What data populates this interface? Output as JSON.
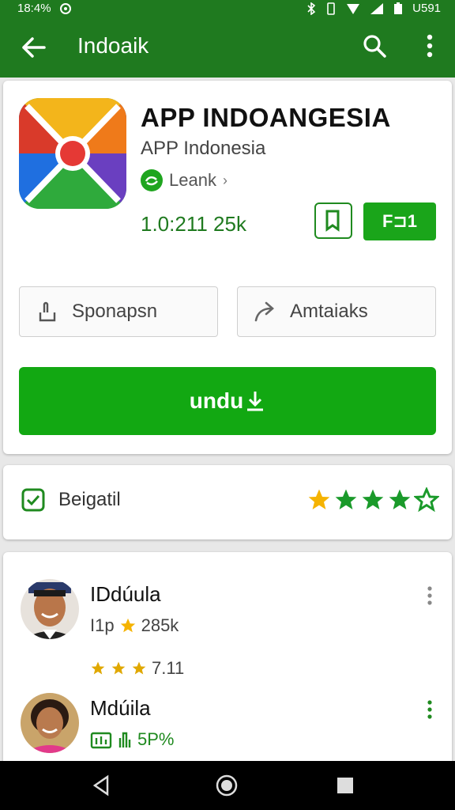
{
  "status_bar": {
    "left_text": "18:4%",
    "right_text": "U591"
  },
  "app_bar": {
    "title": "Indoaik"
  },
  "app": {
    "name": "APP INDOANGESIA",
    "subtitle": "APP Indonesia",
    "developer": "Leank",
    "stats": "1.0:211 25k",
    "badge_button_label": "F⊐1"
  },
  "actions": {
    "left_label": "Sponapsn",
    "right_label": "Amtaiaks",
    "install_label": "undu"
  },
  "rating": {
    "label": "Beigatil",
    "stars_filled": 4,
    "stars_total": 5
  },
  "reviews": [
    {
      "name": "IDdúula",
      "meta_prefix": "I1p",
      "meta_value": "285k",
      "sub_value": "7.11"
    },
    {
      "name": "Mdúila",
      "meta_value": "5P%"
    }
  ],
  "colors": {
    "brand": "#1f7a1f",
    "accent": "#12a812",
    "star": "#f5b301"
  }
}
